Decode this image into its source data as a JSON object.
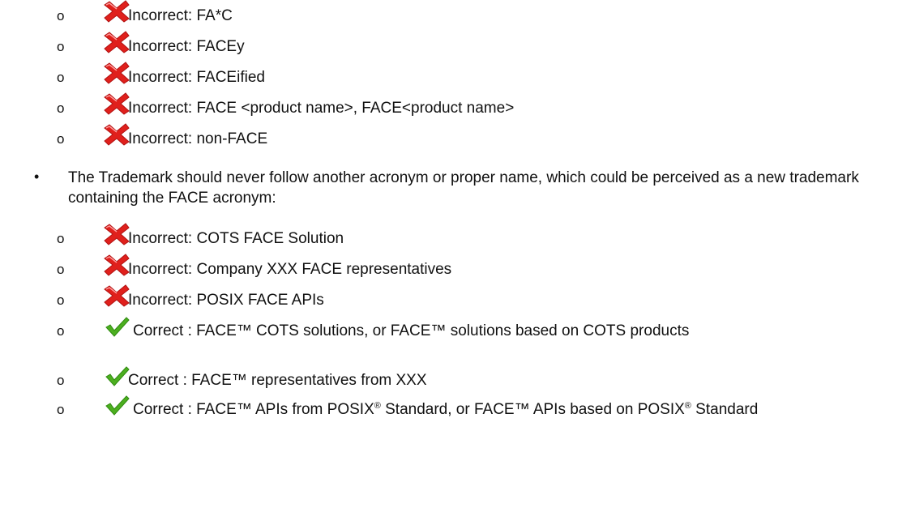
{
  "sub_marker": "o",
  "bullet_marker": "•",
  "incorrect_items_1": [
    "Incorrect: FA*C",
    "Incorrect: FACEy",
    "Incorrect: FACEified",
    "Incorrect: FACE <product name>, FACE<product name>",
    "Incorrect: non-FACE"
  ],
  "bullet_text": "The Trademark should never follow another acronym or proper name, which could be perceived as a new trademark containing the FACE acronym:",
  "incorrect_items_2": [
    "Incorrect: COTS FACE Solution",
    "Incorrect:  Company XXX FACE representatives",
    "Incorrect:  POSIX FACE APIs"
  ],
  "correct_items": [
    "Correct  :  FACE™ COTS solutions, or FACE™ solutions based on COTS products",
    "Correct  :  FACE™ representatives from XXX"
  ],
  "correct_posix": {
    "part1": "Correct  :  FACE™ APIs from POSIX",
    "reg1": "®",
    "part2": " Standard, or FACE™ APIs based on POSIX",
    "reg2": "®",
    "part3": " Standard"
  },
  "colors": {
    "incorrect_icon": "#e0201c",
    "correct_icon": "#4caf1f"
  },
  "icons": {
    "incorrect": "red-x-icon",
    "correct": "green-check-icon"
  }
}
